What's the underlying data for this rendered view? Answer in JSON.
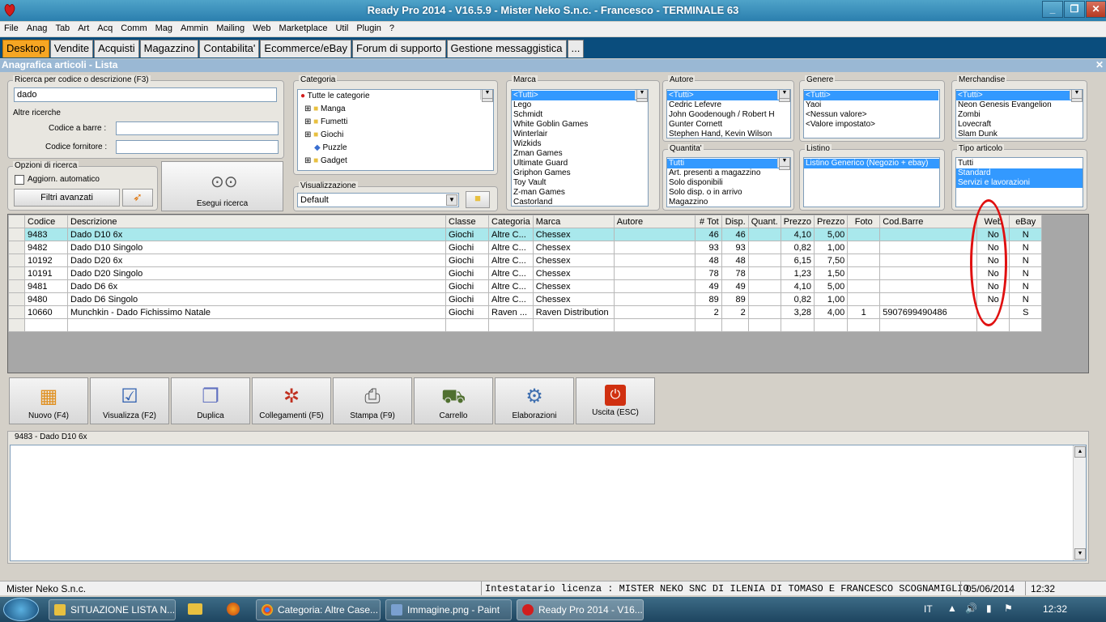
{
  "window": {
    "title": "Ready Pro 2014 - V16.5.9 - Mister Neko S.n.c. - Francesco - TERMINALE 63"
  },
  "menu": [
    "File",
    "Anag",
    "Tab",
    "Art",
    "Acq",
    "Comm",
    "Mag",
    "Ammin",
    "Mailing",
    "Web",
    "Marketplace",
    "Util",
    "Plugin",
    "?"
  ],
  "tabs": [
    "Desktop",
    "Vendite",
    "Acquisti",
    "Magazzino",
    "Contabilita'",
    "Ecommerce/eBay",
    "Forum di supporto",
    "Gestione messaggistica",
    "..."
  ],
  "section": {
    "title": "Anagrafica articoli  - Lista"
  },
  "search": {
    "label": "Ricerca per codice o descrizione (F3)",
    "value": "dado",
    "other_label": "Altre ricerche",
    "barcode_label": "Codice a barre :",
    "supplier_label": "Codice fornitore :"
  },
  "options": {
    "label": "Opzioni di ricerca",
    "auto_update": "Aggiorn. automatico",
    "advanced_filters": "Filtri avanzati",
    "run_search": "Esegui ricerca"
  },
  "categoria": {
    "label": "Categoria",
    "root": "Tutte le categorie",
    "items": [
      "Manga",
      "Fumetti",
      "Giochi",
      "Puzzle",
      "Gadget"
    ]
  },
  "visualizzazione": {
    "label": "Visualizzazione",
    "value": "Default"
  },
  "marca": {
    "label": "Marca",
    "items": [
      "<Tutti>",
      "Lego",
      "Schmidt",
      "White Goblin Games",
      "Winterlair",
      "Wizkids",
      "Zman Games",
      "Ultimate Guard",
      "Griphon Games",
      "Toy Vault",
      "Z-man Games",
      "Castorland"
    ]
  },
  "autore": {
    "label": "Autore",
    "items": [
      "<Tutti>",
      "Cedric Lefevre",
      "John Goodenough / Robert H",
      "Gunter Cornett",
      "Stephen Hand, Kevin Wilson"
    ]
  },
  "genere": {
    "label": "Genere",
    "items": [
      "<Tutti>",
      "Yaoi",
      "<Nessun valore>",
      "<Valore impostato>"
    ]
  },
  "merchandise": {
    "label": "Merchandise",
    "items": [
      "<Tutti>",
      "Neon Genesis Evangelion",
      "Zombi",
      "Lovecraft",
      "Slam Dunk"
    ]
  },
  "quantita": {
    "label": "Quantita'",
    "items": [
      "Tutti",
      "Art. presenti a magazzino",
      "Solo disponibili",
      "Solo disp. o in arrivo",
      "Magazzino"
    ]
  },
  "listino": {
    "label": "Listino",
    "items": [
      "Listino Generico (Negozio + ebay)"
    ]
  },
  "tipo_articolo": {
    "label": "Tipo articolo",
    "items": [
      "Tutti",
      "Standard",
      "Servizi e lavorazioni"
    ]
  },
  "grid": {
    "columns": [
      "Codice",
      "Descrizione",
      "Classe",
      "Categoria",
      "Marca",
      "Autore",
      "# Tot",
      "Disp.",
      "Quant.",
      "Prezzo",
      "Prezzo",
      "Foto",
      "Cod.Barre",
      "Web",
      "eBay"
    ],
    "rows": [
      [
        "9483",
        "Dado D10 6x",
        "Giochi",
        "Altre C...",
        "Chessex",
        "",
        "46",
        "46",
        "",
        "4,10",
        "5,00",
        "",
        "",
        "No",
        "N"
      ],
      [
        "9482",
        "Dado D10 Singolo",
        "Giochi",
        "Altre C...",
        "Chessex",
        "",
        "93",
        "93",
        "",
        "0,82",
        "1,00",
        "",
        "",
        "No",
        "N"
      ],
      [
        "10192",
        "Dado D20 6x",
        "Giochi",
        "Altre C...",
        "Chessex",
        "",
        "48",
        "48",
        "",
        "6,15",
        "7,50",
        "",
        "",
        "No",
        "N"
      ],
      [
        "10191",
        "Dado D20 Singolo",
        "Giochi",
        "Altre C...",
        "Chessex",
        "",
        "78",
        "78",
        "",
        "1,23",
        "1,50",
        "",
        "",
        "No",
        "N"
      ],
      [
        "9481",
        "Dado D6 6x",
        "Giochi",
        "Altre C...",
        "Chessex",
        "",
        "49",
        "49",
        "",
        "4,10",
        "5,00",
        "",
        "",
        "No",
        "N"
      ],
      [
        "9480",
        "Dado D6 Singolo",
        "Giochi",
        "Altre C...",
        "Chessex",
        "",
        "89",
        "89",
        "",
        "0,82",
        "1,00",
        "",
        "",
        "No",
        "N"
      ],
      [
        "10660",
        "Munchkin - Dado Fichissimo Natale",
        "Giochi",
        "Raven ...",
        "Raven Distribution",
        "",
        "2",
        "2",
        "",
        "3,28",
        "4,00",
        "1",
        "5907699490486",
        "",
        "S"
      ]
    ]
  },
  "toolbar": [
    "Nuovo (F4)",
    "Visualizza (F2)",
    "Duplica",
    "Collegamenti (F5)",
    "Stampa (F9)",
    "Carrello",
    "Elaborazioni",
    "Uscita (ESC)"
  ],
  "notes": {
    "title": "9483 - Dado D10 6x"
  },
  "status": {
    "company": "Mister Neko S.n.c.",
    "license": "Intestatario licenza : MISTER NEKO SNC DI ILENIA DI TOMASO E FRANCESCO SCOGNAMIGLIO",
    "date": "05/06/2014",
    "time": "12:32"
  },
  "taskbar": {
    "items": [
      "SITUAZIONE LISTA N...",
      "Categoria: Altre Case...",
      "Immagine.png - Paint",
      "Ready Pro 2014 - V16..."
    ],
    "lang": "IT",
    "clock": "12:32"
  }
}
